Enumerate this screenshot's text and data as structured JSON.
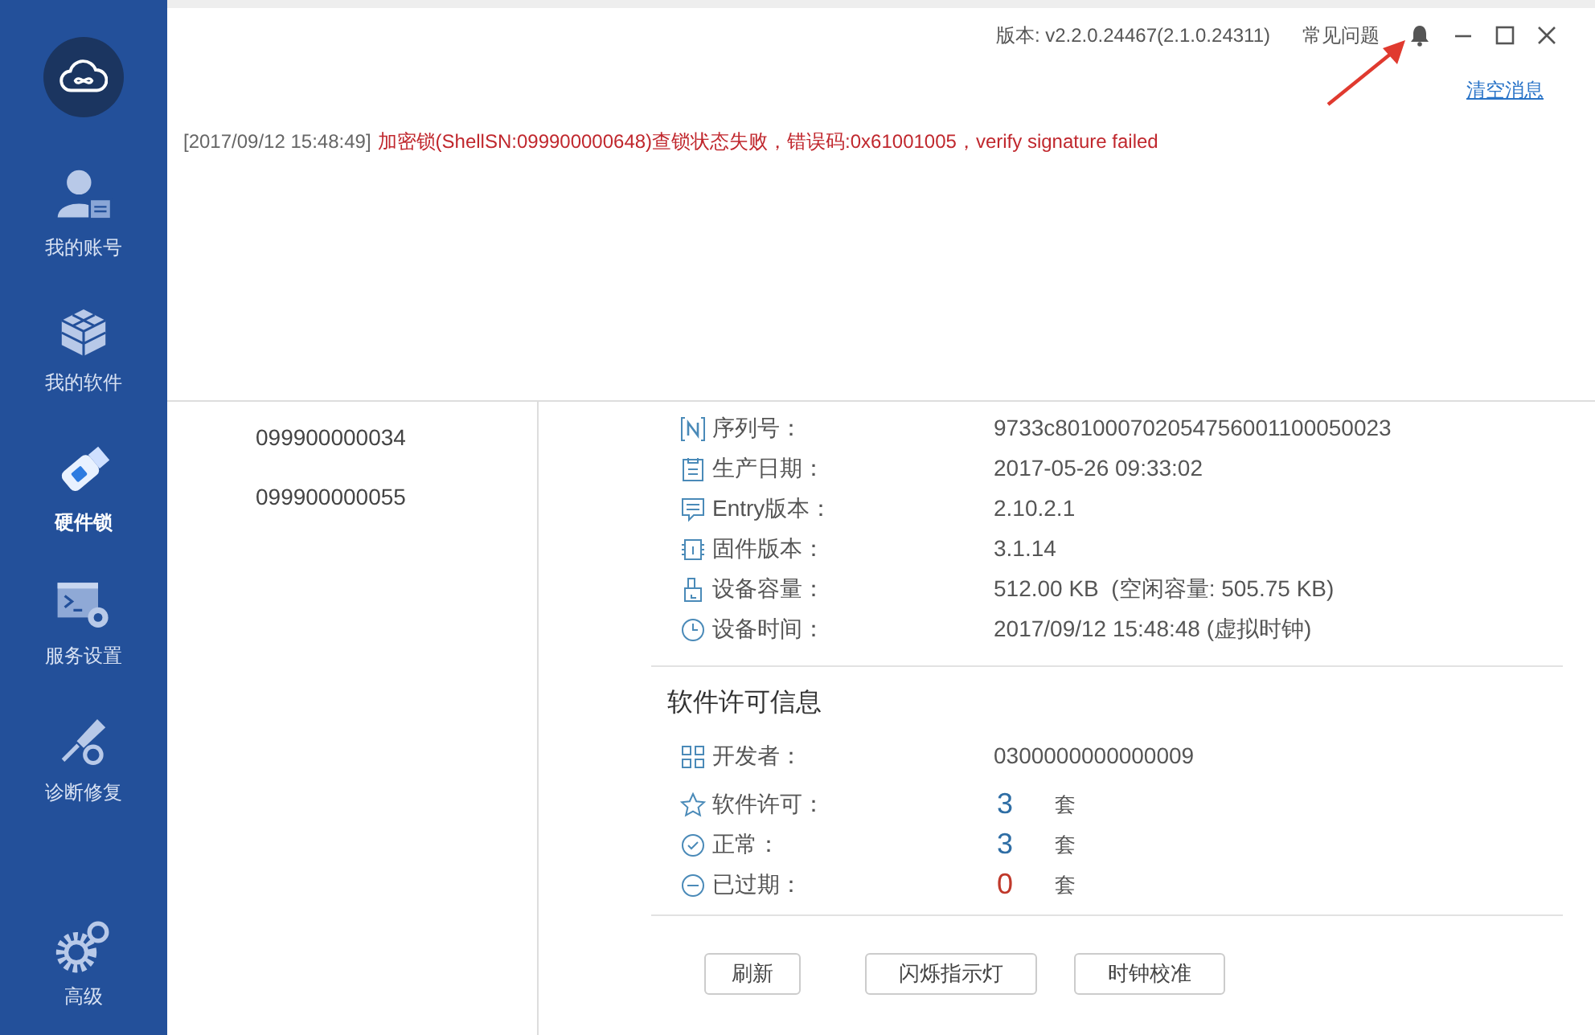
{
  "window": {
    "version": "版本: v2.2.0.24467(2.1.0.24311)",
    "help_link": "常见问题"
  },
  "sidebar": {
    "items": [
      {
        "kind": "account",
        "label": "我的账号",
        "selected": false
      },
      {
        "kind": "software",
        "label": "我的软件",
        "selected": false
      },
      {
        "kind": "hardware",
        "label": "硬件锁",
        "selected": true
      },
      {
        "kind": "service",
        "label": "服务设置",
        "selected": false
      },
      {
        "kind": "repair",
        "label": "诊断修复",
        "selected": false
      }
    ],
    "bottom_item": {
      "kind": "advanced",
      "label": "高级"
    }
  },
  "notifications": {
    "clear_link": "清空消息",
    "messages": [
      {
        "time": "[2017/09/12 15:48:49]",
        "text": "加密锁(ShellSN:099900000648)查锁状态失败，错误码:0x61001005，verify signature failed"
      }
    ]
  },
  "lock_list": {
    "items": [
      "099900000034",
      "099900000055"
    ]
  },
  "device_info": {
    "rows": [
      {
        "kind": "serial",
        "label": "序列号：",
        "value": "9733c801000702054756001100050023"
      },
      {
        "kind": "date",
        "label": "生产日期：",
        "value": "2017-05-26 09:33:02"
      },
      {
        "kind": "entry",
        "label": "Entry版本：",
        "value": "2.10.2.1"
      },
      {
        "kind": "chip",
        "label": "固件版本：",
        "value": "3.1.14"
      },
      {
        "kind": "storage",
        "label": "设备容量：",
        "value": "512.00 KB  (空闲容量: 505.75 KB)"
      },
      {
        "kind": "clock",
        "label": "设备时间：",
        "value": "2017/09/12 15:48:48 (虚拟时钟)"
      }
    ]
  },
  "license_info": {
    "title": "软件许可信息",
    "developer": {
      "label": "开发者：",
      "value": "0300000000000009"
    },
    "counts": [
      {
        "kind": "star",
        "label": "软件许可：",
        "count": "3",
        "unit": "套",
        "color": "#2f6ea5"
      },
      {
        "kind": "check",
        "label": "正常：",
        "count": "3",
        "unit": "套",
        "color": "#2f6ea5"
      },
      {
        "kind": "minus",
        "label": "已过期：",
        "count": "0",
        "unit": "套",
        "color": "#c0392b"
      }
    ]
  },
  "buttons": [
    "刷新",
    "闪烁指示灯",
    "时钟校准"
  ]
}
